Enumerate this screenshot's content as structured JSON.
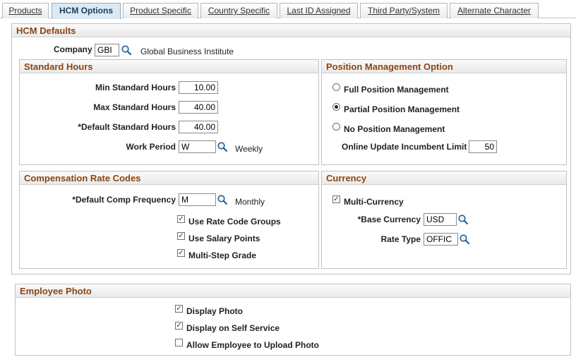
{
  "tabs": [
    {
      "label": "Products",
      "active": false
    },
    {
      "label": "HCM Options",
      "active": true
    },
    {
      "label": "Product Specific",
      "active": false
    },
    {
      "label": "Country Specific",
      "active": false
    },
    {
      "label": "Last ID Assigned",
      "active": false
    },
    {
      "label": "Third Party/System",
      "active": false
    },
    {
      "label": "Alternate Character",
      "active": false
    }
  ],
  "hcm_defaults": {
    "title": "HCM Defaults",
    "company": {
      "label": "Company",
      "value": "GBI",
      "description": "Global Business Institute"
    }
  },
  "standard_hours": {
    "title": "Standard Hours",
    "min": {
      "label": "Min Standard Hours",
      "value": "10.00"
    },
    "max": {
      "label": "Max Standard Hours",
      "value": "40.00"
    },
    "default": {
      "label": "*Default Standard Hours",
      "value": "40.00"
    },
    "work_period": {
      "label": "Work Period",
      "value": "W",
      "description": "Weekly"
    }
  },
  "position_management": {
    "title": "Position Management Option",
    "options": [
      {
        "label": "Full Position Management",
        "selected": false
      },
      {
        "label": "Partial Position Management",
        "selected": true
      },
      {
        "label": "No Position Management",
        "selected": false
      }
    ],
    "incumbent_limit": {
      "label": "Online Update Incumbent Limit",
      "value": "50"
    }
  },
  "comp_rate_codes": {
    "title": "Compensation Rate Codes",
    "default_comp_frequency": {
      "label": "*Default Comp Frequency",
      "value": "M",
      "description": "Monthly"
    },
    "checkboxes": [
      {
        "label": "Use Rate Code Groups",
        "checked": true
      },
      {
        "label": "Use Salary Points",
        "checked": true
      },
      {
        "label": "Multi-Step Grade",
        "checked": true
      }
    ]
  },
  "currency": {
    "title": "Currency",
    "multi_currency": {
      "label": "Multi-Currency",
      "checked": true
    },
    "base_currency": {
      "label": "*Base Currency",
      "value": "USD"
    },
    "rate_type": {
      "label": "Rate Type",
      "value": "OFFIC"
    }
  },
  "employee_photo": {
    "title": "Employee Photo",
    "checkboxes": [
      {
        "label": "Display Photo",
        "checked": true
      },
      {
        "label": "Display on Self Service",
        "checked": true
      },
      {
        "label": "Allow Employee to Upload Photo",
        "checked": false
      }
    ]
  },
  "icons": {
    "lookup": "magnifier-lookup-icon",
    "check": "✓"
  }
}
